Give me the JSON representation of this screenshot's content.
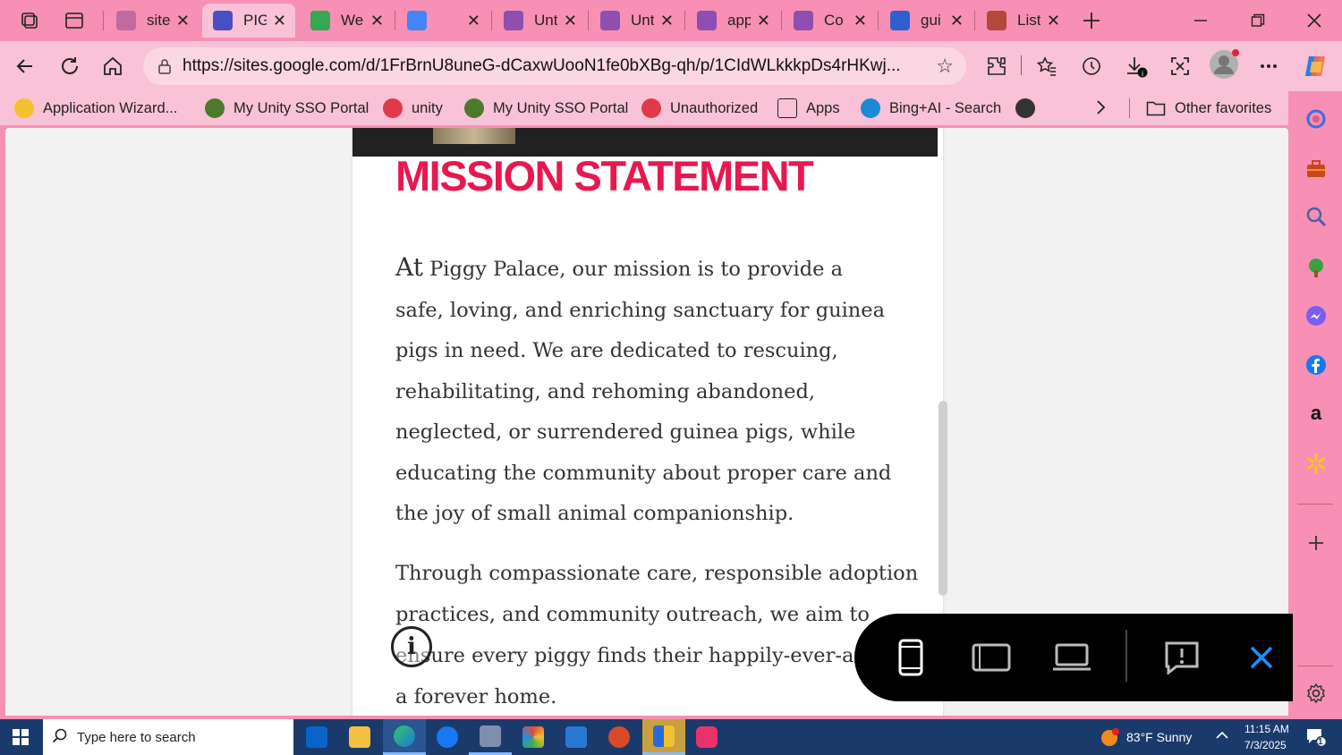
{
  "tabs": [
    {
      "title": "site",
      "fav": "search-icon",
      "color": "#c06aa0",
      "active": false
    },
    {
      "title": "PIG",
      "fav": "sites-icon",
      "color": "#4a4fc4",
      "active": true
    },
    {
      "title": "We",
      "fav": "drive-icon",
      "color": "#34a853",
      "active": false
    },
    {
      "title": "",
      "fav": "docs-icon",
      "color": "#4285f4",
      "active": false
    },
    {
      "title": "Unt",
      "fav": "forms-icon",
      "color": "#8e4fb0",
      "active": false
    },
    {
      "title": "Unt",
      "fav": "forms-icon",
      "color": "#8e4fb0",
      "active": false
    },
    {
      "title": "app",
      "fav": "forms-icon",
      "color": "#8e4fb0",
      "active": false
    },
    {
      "title": "Co",
      "fav": "forms-icon",
      "color": "#8e4fb0",
      "active": false
    },
    {
      "title": "gui",
      "fav": "search-icon",
      "color": "#2f5fd0",
      "active": false
    },
    {
      "title": "List",
      "fav": "guinea-pig-icon",
      "color": "#b5483a",
      "active": false
    }
  ],
  "address": {
    "url": "https://sites.google.com/d/1FrBrnU8uneG-dCaxwUooN1fe0bXBg-qh/p/1CIdWLkkkpDs4rHKwj..."
  },
  "bookmarks": [
    {
      "label": "Application Wizard...",
      "icon": "wizard-icon"
    },
    {
      "label": "My Unity SSO Portal",
      "icon": "shield-icon"
    },
    {
      "label": "unity",
      "icon": "unity-icon"
    },
    {
      "label": "My Unity SSO Portal",
      "icon": "shield-icon"
    },
    {
      "label": "Unauthorized",
      "icon": "unity-icon"
    },
    {
      "label": "Apps",
      "icon": "apps-icon"
    },
    {
      "label": "Bing+AI - Search",
      "icon": "bing-icon"
    },
    {
      "label": "",
      "icon": "app-icon"
    }
  ],
  "other_favorites": "Other favorites",
  "content": {
    "heading": "MISSION STATEMENT",
    "p1_first": "At",
    "p1_rest": " Piggy Palace, our mission is to provide a safe, loving, and enriching sanctuary for guinea pigs in need. We are dedicated to rescuing, rehabilitating, and rehoming abandoned, neglected, or surrendered guinea pigs, while educating the community about proper care and the joy of small animal companionship.",
    "p2": "Through compassionate care, responsible adoption practices, and community outreach, we aim to ensure every piggy finds their happily-ever-after in a forever home."
  },
  "taskbar": {
    "search_placeholder": "Type here to search",
    "weather": "83°F  Sunny",
    "time": "11:15 AM",
    "date": "7/3/2025",
    "notif_count": "1"
  }
}
